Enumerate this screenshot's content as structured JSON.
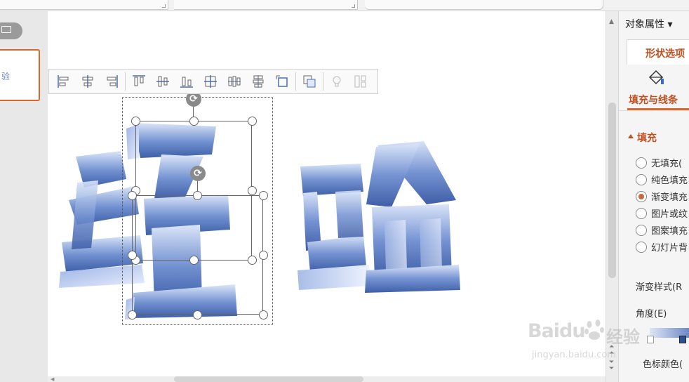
{
  "pane": {
    "title": "对象属性",
    "tab": "形状选项",
    "subtab": "填充与线条",
    "section": "填充",
    "options": [
      {
        "label": "无填充(",
        "selected": false
      },
      {
        "label": "纯色填充",
        "selected": false
      },
      {
        "label": "渐变填充",
        "selected": true
      },
      {
        "label": "图片或纹",
        "selected": false
      },
      {
        "label": "图案填充",
        "selected": false
      },
      {
        "label": "幻灯片背",
        "selected": false
      }
    ],
    "gradient_style_label": "渐变样式(R",
    "angle_label": "角度(E)",
    "stop_color_label": "色标颜色(",
    "gradient_colors": [
      "#dfe7f6",
      "#5170b9"
    ]
  },
  "canvas": {
    "word_art": [
      "经",
      "验"
    ],
    "art_color": "#4f6fb5"
  },
  "thumbnail": {
    "glyph": "验"
  },
  "watermark": {
    "brand": "Baidu",
    "cn": "经验",
    "url": "jingyan.baidu.com"
  },
  "toolbar_icons": [
    "align-left-icon",
    "align-center-icon",
    "align-right-icon",
    "align-top-icon",
    "align-middle-icon",
    "align-bottom-icon",
    "center-both-icon",
    "distribute-horizontal-icon",
    "distribute-vertical-icon",
    "fit-canvas-icon",
    "group-icon",
    "lightbulb-icon",
    "more-layout-icon"
  ]
}
